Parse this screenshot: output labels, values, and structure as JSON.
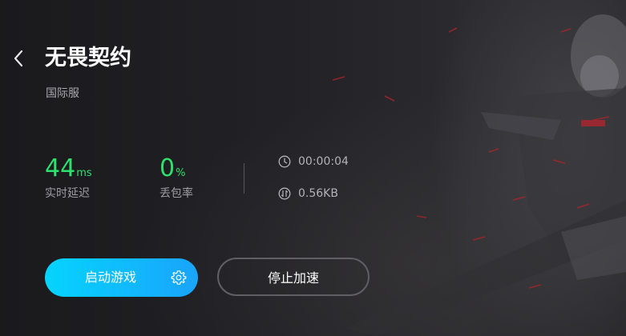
{
  "game": {
    "title": "无畏契约",
    "server": "国际服"
  },
  "stats": {
    "latency": {
      "value": "44",
      "unit": "ms",
      "label": "实时延迟"
    },
    "packet_loss": {
      "value": "0",
      "unit": "%",
      "label": "丢包率"
    }
  },
  "session": {
    "duration": "00:00:04",
    "traffic": "0.56KB"
  },
  "actions": {
    "start_label": "启动游戏",
    "stop_label": "停止加速"
  },
  "icons": {
    "back": "chevron-left-icon",
    "clock": "clock-icon",
    "traffic": "traffic-icon",
    "settings": "gear-icon"
  },
  "colors": {
    "accent_green": "#2ee06d",
    "button_gradient_start": "#05d4fd",
    "button_gradient_end": "#1aa4fb",
    "background": "#1c1c1f"
  }
}
